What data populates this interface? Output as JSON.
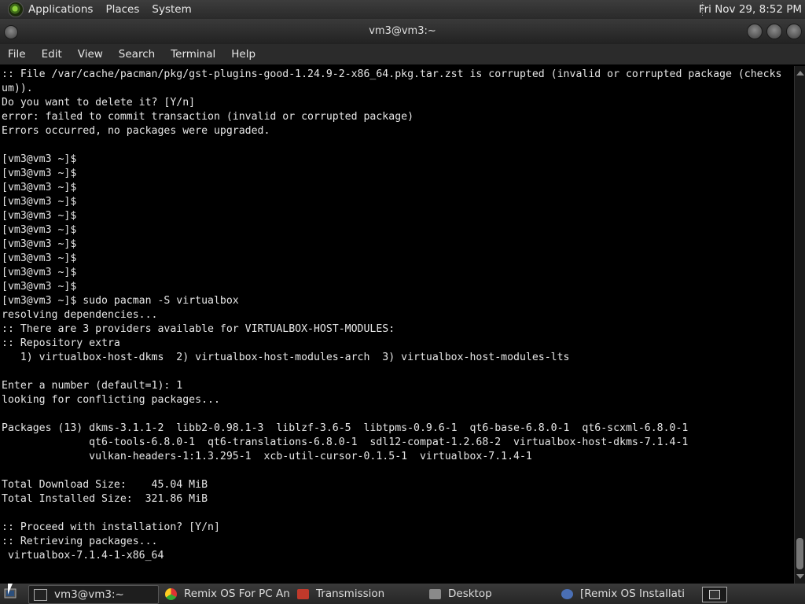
{
  "top_panel": {
    "menus": [
      "Applications",
      "Places",
      "System"
    ],
    "clock": "Fri Nov 29,  8:52 PM"
  },
  "window": {
    "title": "vm3@vm3:~"
  },
  "menubar": [
    "File",
    "Edit",
    "View",
    "Search",
    "Terminal",
    "Help"
  ],
  "terminal": {
    "lines": [
      ":: File /var/cache/pacman/pkg/gst-plugins-good-1.24.9-2-x86_64.pkg.tar.zst is corrupted (invalid or corrupted package (checks",
      "um)).",
      "Do you want to delete it? [Y/n]",
      "error: failed to commit transaction (invalid or corrupted package)",
      "Errors occurred, no packages were upgraded.",
      "",
      "[vm3@vm3 ~]$",
      "[vm3@vm3 ~]$",
      "[vm3@vm3 ~]$",
      "[vm3@vm3 ~]$",
      "[vm3@vm3 ~]$",
      "[vm3@vm3 ~]$",
      "[vm3@vm3 ~]$",
      "[vm3@vm3 ~]$",
      "[vm3@vm3 ~]$",
      "[vm3@vm3 ~]$",
      "[vm3@vm3 ~]$ sudo pacman -S virtualbox",
      "resolving dependencies...",
      ":: There are 3 providers available for VIRTUALBOX-HOST-MODULES:",
      ":: Repository extra",
      "   1) virtualbox-host-dkms  2) virtualbox-host-modules-arch  3) virtualbox-host-modules-lts",
      "",
      "Enter a number (default=1): 1",
      "looking for conflicting packages...",
      "",
      "Packages (13) dkms-3.1.1-2  libb2-0.98.1-3  liblzf-3.6-5  libtpms-0.9.6-1  qt6-base-6.8.0-1  qt6-scxml-6.8.0-1",
      "              qt6-tools-6.8.0-1  qt6-translations-6.8.0-1  sdl12-compat-1.2.68-2  virtualbox-host-dkms-7.1.4-1",
      "              vulkan-headers-1:1.3.295-1  xcb-util-cursor-0.1.5-1  virtualbox-7.1.4-1",
      "",
      "Total Download Size:    45.04 MiB",
      "Total Installed Size:  321.86 MiB",
      "",
      ":: Proceed with installation? [Y/n]",
      ":: Retrieving packages...",
      " virtualbox-7.1.4-1-x86_64"
    ]
  },
  "taskbar": {
    "tasks": [
      {
        "label": "vm3@vm3:~",
        "icon": "terminal-icon"
      },
      {
        "label": "Remix OS For PC An...",
        "icon": "chrome-icon"
      },
      {
        "label": "Transmission",
        "icon": "transmission-icon"
      },
      {
        "label": "Desktop",
        "icon": "folder-icon"
      },
      {
        "label": "[Remix OS Installati...",
        "icon": "browser-icon"
      }
    ]
  }
}
